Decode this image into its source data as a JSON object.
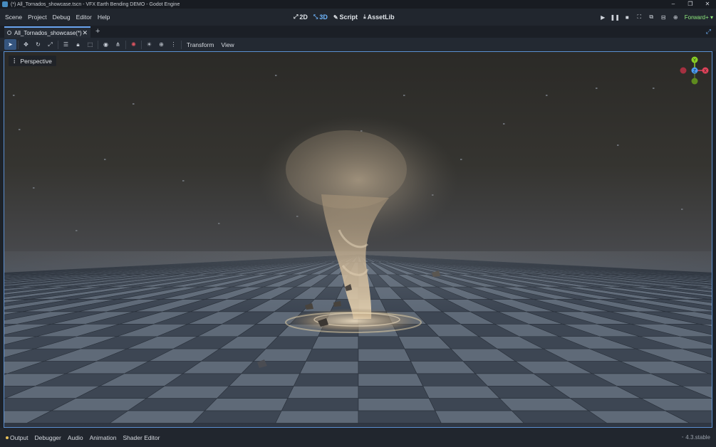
{
  "window": {
    "title": "(*) All_Tornados_showcase.tscn - VFX Earth Bending DEMO - Godot Engine",
    "controls": [
      "–",
      "❐",
      "✕"
    ]
  },
  "menu": {
    "items": [
      "Scene",
      "Project",
      "Debug",
      "Editor",
      "Help"
    ]
  },
  "workspaces": {
    "2d": "2D",
    "3d": "3D",
    "script": "Script",
    "assetlib": "AssetLib",
    "active": "3D"
  },
  "renderer": {
    "label": "Forward+ ▾"
  },
  "tabs": {
    "scene_tab": "All_Tornados_showcase(*)",
    "add": "+"
  },
  "toolbar": {
    "transform_menu": "Transform",
    "view_menu": "View"
  },
  "viewport": {
    "mode_label": "Perspective",
    "gizmo": {
      "y": "Y",
      "z": "Z",
      "x": "X"
    }
  },
  "bottom_panel": {
    "tabs": [
      "Output",
      "Debugger",
      "Audio",
      "Animation",
      "Shader Editor"
    ],
    "version": "4.3.stable"
  },
  "colors": {
    "accent": "#70b7ff",
    "renderer_green": "#8eea7d",
    "axis_x": "#e0435a",
    "axis_y": "#8ad024",
    "axis_z": "#4a9df5",
    "tornado": "#b8a488"
  }
}
